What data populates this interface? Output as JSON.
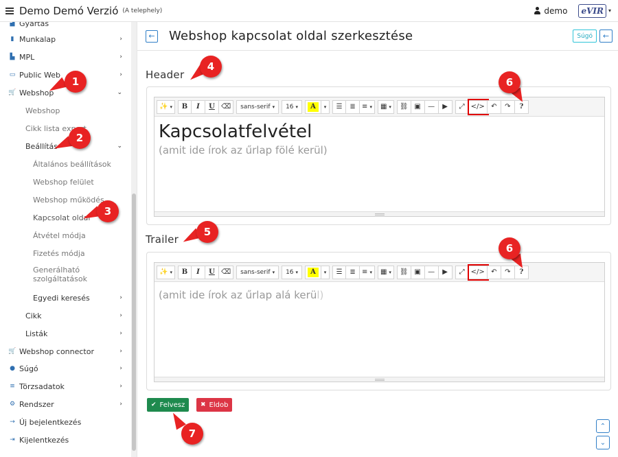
{
  "topbar": {
    "title": "Demo Demó Verzió",
    "subtitle": "(A telephely)",
    "user": "demo",
    "logo_text": "eVIR",
    "logo_caret": "▾"
  },
  "sidebar": {
    "items": [
      {
        "label": "Gyártás",
        "icon": "factory-icon"
      },
      {
        "label": "Munkalap",
        "icon": "file-icon"
      },
      {
        "label": "MPL",
        "icon": "truck-icon"
      },
      {
        "label": "Public Web",
        "icon": "monitor-icon"
      },
      {
        "label": "Webshop",
        "icon": "cart-icon"
      },
      {
        "label": "Webshop"
      },
      {
        "label": "Cikk lista export"
      },
      {
        "label": "Beállítás"
      },
      {
        "label": "Általános beállítások"
      },
      {
        "label": "Webshop felület"
      },
      {
        "label": "Webshop működés"
      },
      {
        "label": "Kapcsolat oldal"
      },
      {
        "label": "Átvétel módja"
      },
      {
        "label": "Fizetés módja"
      },
      {
        "label": "Generálható szolgáltatások"
      },
      {
        "label": "Egyedi keresés"
      },
      {
        "label": "Cikk"
      },
      {
        "label": "Listák"
      },
      {
        "label": "Webshop connector",
        "icon": "cart-icon"
      },
      {
        "label": "Súgó",
        "icon": "question-icon"
      },
      {
        "label": "Törzsadatok",
        "icon": "database-icon"
      },
      {
        "label": "Rendszer",
        "icon": "gears-icon"
      },
      {
        "label": "Új bejelentkezés",
        "icon": "login-icon"
      },
      {
        "label": "Kijelentkezés",
        "icon": "logout-icon"
      }
    ],
    "chevron_right": "›",
    "chevron_down": "⌄"
  },
  "main": {
    "title": "Webshop kapcsolat oldal szerkesztése",
    "help_label": "Súgó",
    "back_glyph": "←",
    "header_label": "Header",
    "trailer_label": "Trailer",
    "header_editor": {
      "heading": "Kapcsolatfelvétel",
      "hint": "(amit ide írok az űrlap fölé kerül)"
    },
    "trailer_editor": {
      "hint_main": "(amit ide írok az űrlap alá kerü",
      "hint_tail": "l)"
    },
    "toolbar": {
      "magic": "✨",
      "bold": "B",
      "italic": "I",
      "underline": "U",
      "eraser": "⌫",
      "font": "sans-serif",
      "size": "16",
      "highlight": "A",
      "ul": "☰",
      "ol": "≣",
      "align": "≡",
      "table": "▦",
      "link": "⛓",
      "image": "▣",
      "hr": "—",
      "video": "▶",
      "fullscreen": "⤢",
      "code": "</>",
      "undo": "↶",
      "redo": "↷",
      "help": "?",
      "caret": "▾"
    },
    "save_label": "Felvesz",
    "drop_label": "Eldob",
    "save_icon": "✔",
    "drop_icon": "✖",
    "scroll_up": "⌃",
    "scroll_down": "⌄"
  },
  "markers": [
    "1",
    "2",
    "3",
    "4",
    "5",
    "6",
    "6",
    "7"
  ],
  "colors": {
    "marker": "#e82323",
    "accent": "#2f7ec7",
    "save": "#1e8a4e",
    "drop": "#dc3545"
  }
}
